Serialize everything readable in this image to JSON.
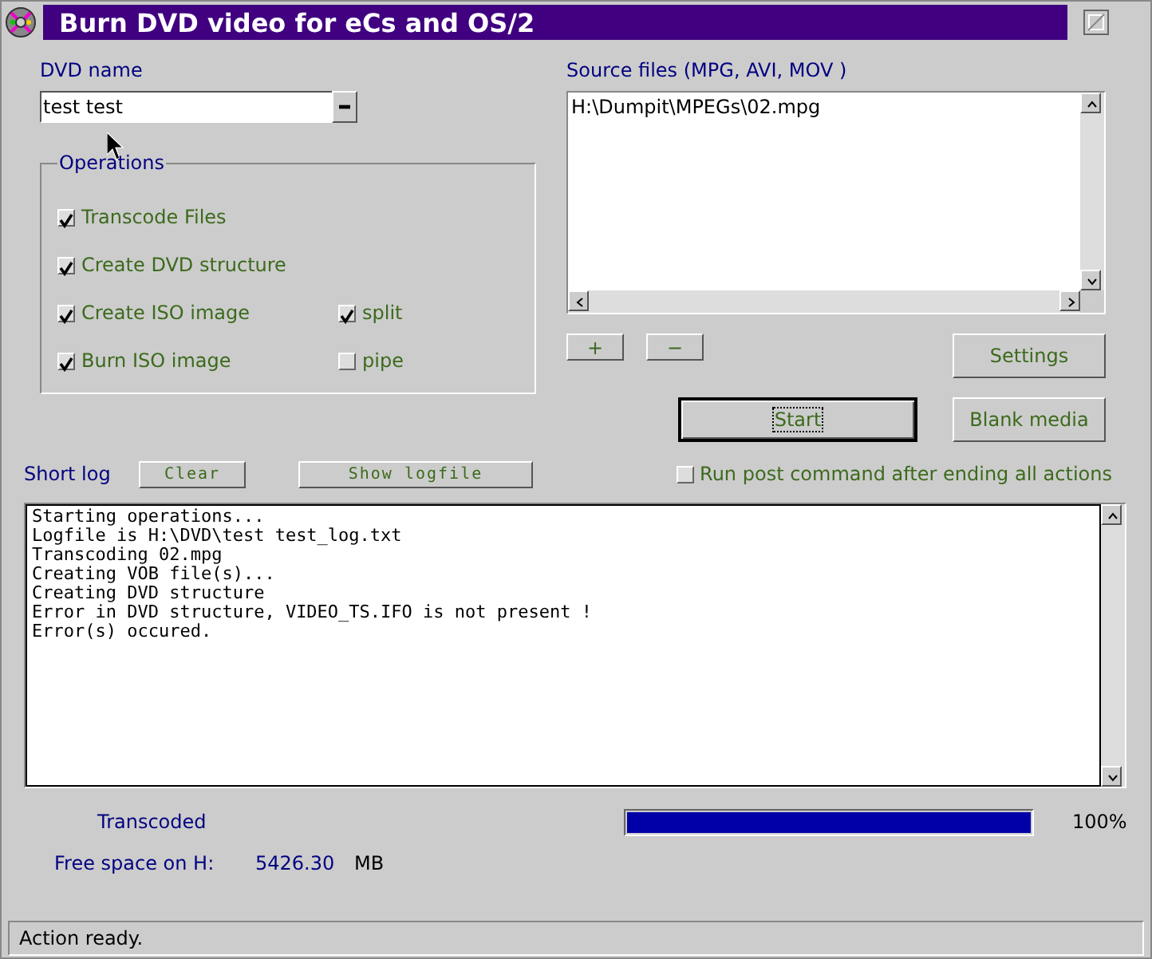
{
  "window": {
    "title": "Burn DVD video for eCs and OS/2"
  },
  "dvd_name": {
    "label": "DVD name",
    "value": "test test"
  },
  "operations": {
    "title": "Operations",
    "items": [
      {
        "label": "Transcode Files",
        "checked": true
      },
      {
        "label": "Create DVD structure",
        "checked": true
      },
      {
        "label": "Create ISO image",
        "checked": true,
        "option": {
          "label": "split",
          "checked": true
        }
      },
      {
        "label": "Burn ISO image",
        "checked": true,
        "option": {
          "label": "pipe",
          "checked": false
        }
      }
    ]
  },
  "source_files": {
    "label": "Source files (MPG, AVI, MOV )",
    "items": [
      "H:\\Dumpit\\MPEGs\\02.mpg"
    ]
  },
  "file_buttons": [
    "+",
    "−"
  ],
  "settings_button": "Settings",
  "start_button": "Start",
  "blank_media_button": "Blank media",
  "short_log": {
    "label": "Short log",
    "clear_button": "Clear",
    "show_button": "Show logfile"
  },
  "post_command": {
    "label": "Run post command after ending all actions",
    "checked": false
  },
  "log_lines": [
    "Starting operations...",
    "Logfile is H:\\DVD\\test test_log.txt",
    "Transcoding 02.mpg",
    "Creating VOB file(s)...",
    "Creating DVD structure",
    "Error in DVD structure, VIDEO_TS.IFO is not present !",
    "Error(s) occured."
  ],
  "progress": {
    "label": "Transcoded",
    "level": 1,
    "reading": "100%"
  },
  "free_space": {
    "label": "Free space on H:",
    "value": "5426.30",
    "unit": "MB"
  },
  "status_bar": "Action ready."
}
